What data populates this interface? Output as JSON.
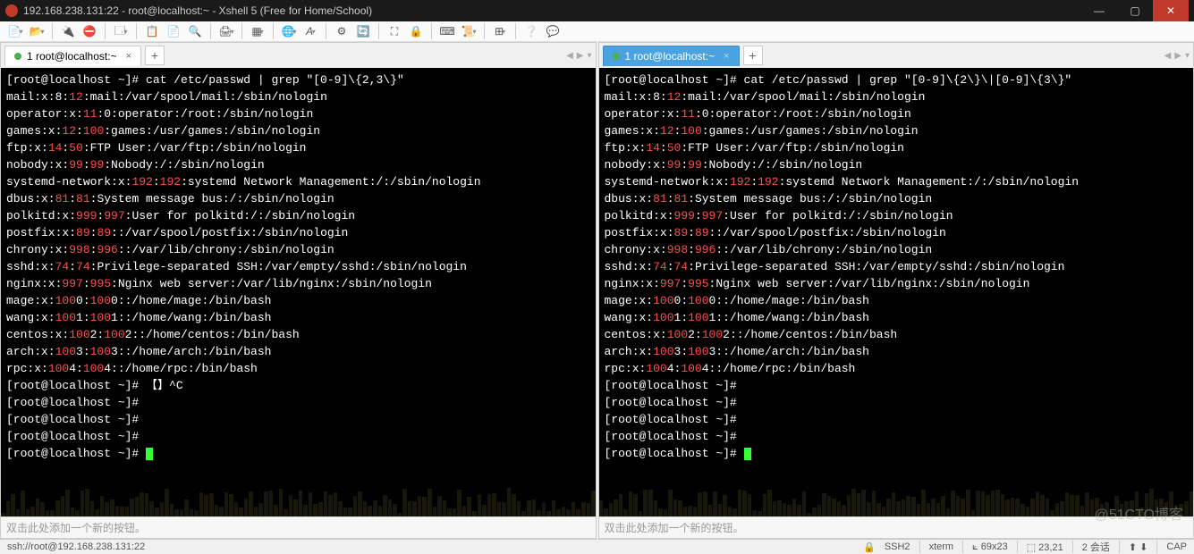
{
  "window": {
    "title": "192.168.238.131:22 - root@localhost:~ - Xshell 5 (Free for Home/School)"
  },
  "tabs": {
    "left": {
      "label": "1 root@localhost:~"
    },
    "right": {
      "label": "1 root@localhost:~"
    }
  },
  "left_cmd_prompt": "[root@localhost ~]# ",
  "left_cmd": "cat /etc/passwd | grep \"[0-9]\\{2,3\\}\"",
  "right_cmd_prompt": "[root@localhost ~]# ",
  "right_cmd": "cat /etc/passwd | grep \"[0-9]\\{2\\}\\|[0-9]\\{3\\}\"",
  "output_lines": [
    [
      [
        "mail:x:8:",
        ""
      ],
      [
        "12",
        "red"
      ],
      [
        ":mail:/var/spool/mail:/sbin/nologin",
        ""
      ]
    ],
    [
      [
        "operator:x:",
        ""
      ],
      [
        "11",
        "red"
      ],
      [
        ":0:operator:/root:/sbin/nologin",
        ""
      ]
    ],
    [
      [
        "games:x:",
        ""
      ],
      [
        "12",
        "red"
      ],
      [
        ":",
        ""
      ],
      [
        "100",
        "red"
      ],
      [
        ":games:/usr/games:/sbin/nologin",
        ""
      ]
    ],
    [
      [
        "ftp:x:",
        ""
      ],
      [
        "14",
        "red"
      ],
      [
        ":",
        ""
      ],
      [
        "50",
        "red"
      ],
      [
        ":FTP User:/var/ftp:/sbin/nologin",
        ""
      ]
    ],
    [
      [
        "nobody:x:",
        ""
      ],
      [
        "99",
        "red"
      ],
      [
        ":",
        ""
      ],
      [
        "99",
        "red"
      ],
      [
        ":Nobody:/:/sbin/nologin",
        ""
      ]
    ],
    [
      [
        "systemd-network:x:",
        ""
      ],
      [
        "192",
        "red"
      ],
      [
        ":",
        ""
      ],
      [
        "192",
        "red"
      ],
      [
        ":systemd Network Management:/:/sbin/nologin",
        ""
      ]
    ],
    [
      [
        "dbus:x:",
        ""
      ],
      [
        "81",
        "red"
      ],
      [
        ":",
        ""
      ],
      [
        "81",
        "red"
      ],
      [
        ":System message bus:/:/sbin/nologin",
        ""
      ]
    ],
    [
      [
        "polkitd:x:",
        ""
      ],
      [
        "999",
        "red"
      ],
      [
        ":",
        ""
      ],
      [
        "997",
        "red"
      ],
      [
        ":User for polkitd:/:/sbin/nologin",
        ""
      ]
    ],
    [
      [
        "postfix:x:",
        ""
      ],
      [
        "89",
        "red"
      ],
      [
        ":",
        ""
      ],
      [
        "89",
        "red"
      ],
      [
        "::/var/spool/postfix:/sbin/nologin",
        ""
      ]
    ],
    [
      [
        "chrony:x:",
        ""
      ],
      [
        "998",
        "red"
      ],
      [
        ":",
        ""
      ],
      [
        "996",
        "red"
      ],
      [
        "::/var/lib/chrony:/sbin/nologin",
        ""
      ]
    ],
    [
      [
        "sshd:x:",
        ""
      ],
      [
        "74",
        "red"
      ],
      [
        ":",
        ""
      ],
      [
        "74",
        "red"
      ],
      [
        ":Privilege-separated SSH:/var/empty/sshd:/sbin/nologin",
        ""
      ]
    ],
    [
      [
        "nginx:x:",
        ""
      ],
      [
        "997",
        "red"
      ],
      [
        ":",
        ""
      ],
      [
        "995",
        "red"
      ],
      [
        ":Nginx web server:/var/lib/nginx:/sbin/nologin",
        ""
      ]
    ],
    [
      [
        "mage:x:",
        ""
      ],
      [
        "100",
        "red"
      ],
      [
        "0:",
        ""
      ],
      [
        "100",
        "red"
      ],
      [
        "0::/home/mage:/bin/bash",
        ""
      ]
    ],
    [
      [
        "wang:x:",
        ""
      ],
      [
        "100",
        "red"
      ],
      [
        "1:",
        ""
      ],
      [
        "100",
        "red"
      ],
      [
        "1::/home/wang:/bin/bash",
        ""
      ]
    ],
    [
      [
        "centos:x:",
        ""
      ],
      [
        "100",
        "red"
      ],
      [
        "2:",
        ""
      ],
      [
        "100",
        "red"
      ],
      [
        "2::/home/centos:/bin/bash",
        ""
      ]
    ],
    [
      [
        "arch:x:",
        ""
      ],
      [
        "100",
        "red"
      ],
      [
        "3:",
        ""
      ],
      [
        "100",
        "red"
      ],
      [
        "3::/home/arch:/bin/bash",
        ""
      ]
    ],
    [
      [
        "rpc:x:",
        ""
      ],
      [
        "100",
        "red"
      ],
      [
        "4:",
        ""
      ],
      [
        "100",
        "red"
      ],
      [
        "4::/home/rpc:/bin/bash",
        ""
      ]
    ]
  ],
  "left_trailing": [
    "[root@localhost ~]# 【】^C",
    "[root@localhost ~]# ",
    "[root@localhost ~]# ",
    "[root@localhost ~]# ",
    "[root@localhost ~]# "
  ],
  "right_trailing": [
    "[root@localhost ~]# ",
    "[root@localhost ~]# ",
    "[root@localhost ~]# ",
    "[root@localhost ~]# ",
    "[root@localhost ~]# "
  ],
  "input_placeholder": "双击此处添加一个新的按钮。",
  "status": {
    "conn": "ssh://root@192.168.238.131:22",
    "ssh": "SSH2",
    "term": "xterm",
    "size": "69x23",
    "cursor": "23,21",
    "sessions": "2 会话",
    "cap": "CAP"
  },
  "watermark": "@51CTO博客"
}
